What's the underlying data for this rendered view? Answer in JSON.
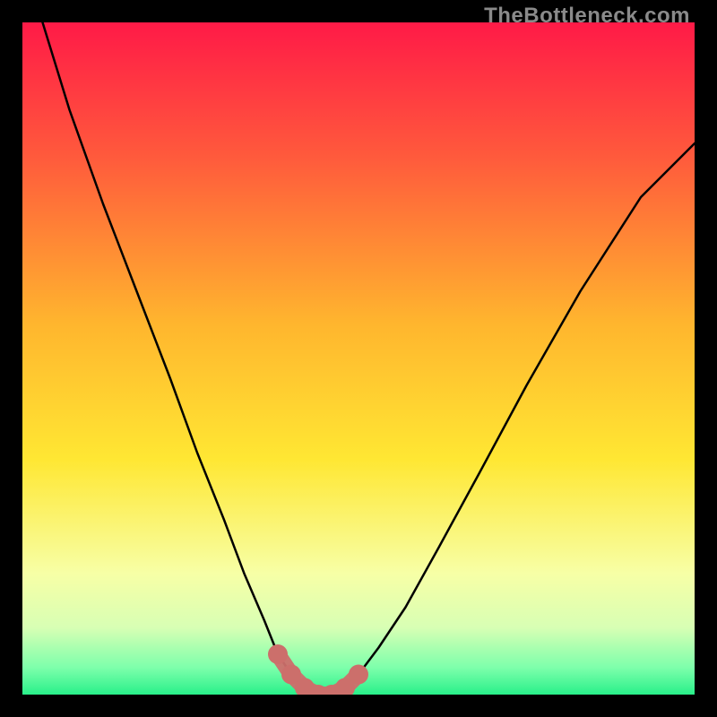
{
  "watermark": "TheBottleneck.com",
  "colors": {
    "page_bg": "#000000",
    "gradient_top": "#ff1a47",
    "gradient_mid1": "#ff8c2b",
    "gradient_mid2": "#ffe733",
    "gradient_mid3": "#f7ffa6",
    "gradient_bottom": "#29f08a",
    "curve": "#000000",
    "marker_fill": "#cc6f6b",
    "marker_stroke": "#b85b57"
  },
  "chart_data": {
    "type": "line",
    "title": "",
    "xlabel": "",
    "ylabel": "",
    "xlim": [
      0,
      100
    ],
    "ylim": [
      0,
      100
    ],
    "grid": false,
    "legend": false,
    "series": [
      {
        "name": "bottleneck-curve",
        "x": [
          3,
          7,
          12,
          17,
          22,
          26,
          30,
          33,
          36,
          38,
          40,
          42,
          44,
          46,
          48,
          50,
          53,
          57,
          62,
          68,
          75,
          83,
          92,
          100
        ],
        "y": [
          100,
          87,
          73,
          60,
          47,
          36,
          26,
          18,
          11,
          6,
          3,
          1,
          0,
          0,
          1,
          3,
          7,
          13,
          22,
          33,
          46,
          60,
          74,
          82
        ]
      }
    ],
    "markers": {
      "name": "highlight-band",
      "x": [
        38,
        40,
        42,
        44,
        46,
        48,
        50
      ],
      "y": [
        6,
        3,
        1,
        0,
        0,
        1,
        3
      ]
    }
  }
}
